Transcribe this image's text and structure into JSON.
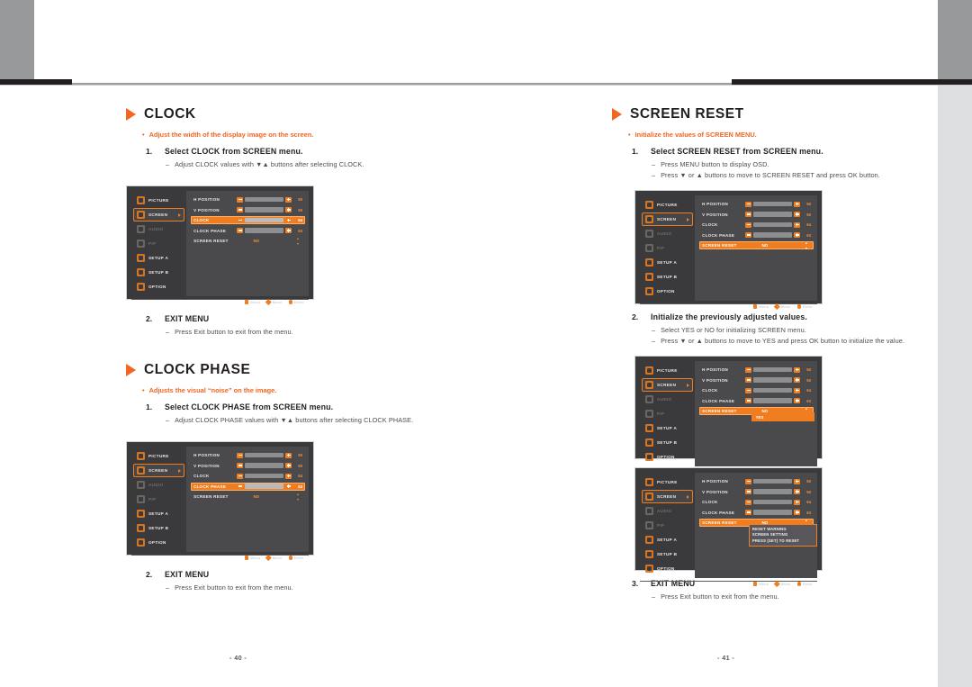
{
  "page": {
    "left_number": "- 40 -",
    "right_number": "- 41 -"
  },
  "accent": "#f26522",
  "osd_accent": "#f07d20",
  "osd": {
    "sidebar": [
      {
        "label": "PICTURE",
        "state": "normal",
        "icon": "picture-icon"
      },
      {
        "label": "SCREEN",
        "state": "selected",
        "icon": "screen-icon"
      },
      {
        "label": "AUDIO",
        "state": "dim",
        "icon": "audio-icon"
      },
      {
        "label": "PIP",
        "state": "dim",
        "icon": "pip-icon"
      },
      {
        "label": "SETUP A",
        "state": "normal",
        "icon": "setup-a-icon"
      },
      {
        "label": "SETUP B",
        "state": "normal",
        "icon": "setup-b-icon"
      },
      {
        "label": "OPTION",
        "state": "normal",
        "icon": "option-icon"
      }
    ],
    "rows": {
      "h_position": "H POSITION",
      "v_position": "V POSITION",
      "clock": "CLOCK",
      "clock_phase": "CLOCK PHASE",
      "screen_reset": "SCREEN RESET"
    },
    "values": {
      "h_position": "50",
      "v_position": "50",
      "clock": "64",
      "clock_phase": "63",
      "screen_reset": "NO"
    },
    "dropdown": {
      "no": "NO",
      "yes": "YES"
    },
    "warning": {
      "line1": "RESET WARNING",
      "line2": "SCREEN SETTING",
      "line3": "PRESS (SET) TO RESET"
    },
    "hints": [
      {
        "label": "Menu",
        "glyph": "square-icon"
      },
      {
        "label": "Move",
        "glyph": "diamond-icon"
      },
      {
        "label": "Enter",
        "glyph": "circle-icon"
      }
    ]
  },
  "left_column": {
    "clock": {
      "title": "CLOCK",
      "bullet": "Adjust the width of the display image on the screen.",
      "step1_num": "1.",
      "step1": "Select CLOCK from SCREEN menu.",
      "step1_sub1": "Adjust CLOCK values with ▼▲ buttons after selecting CLOCK.",
      "step2_num": "2.",
      "step2": "EXIT MENU",
      "step2_sub1": "Press Exit button to exit from the menu."
    },
    "clock_phase": {
      "title": "CLOCK PHASE",
      "bullet": "Adjusts the visual “noise” on the image.",
      "step1_num": "1.",
      "step1": "Select CLOCK PHASE from SCREEN menu.",
      "step1_sub1": "Adjust CLOCK PHASE values with ▼▲ buttons after selecting CLOCK PHASE.",
      "step2_num": "2.",
      "step2": "EXIT MENU",
      "step2_sub1": "Press Exit button to exit from the menu."
    }
  },
  "right_column": {
    "screen_reset": {
      "title": "SCREEN RESET",
      "bullet": "Initialize the values of SCREEN MENU.",
      "step1_num": "1.",
      "step1": "Select SCREEN RESET from SCREEN menu.",
      "step1_sub1": "Press MENU button to display OSD.",
      "step1_sub2": "Press ▼ or ▲ buttons to move to SCREEN RESET and press OK button.",
      "step2_num": "2.",
      "step2": "Initialize the previously adjusted values.",
      "step2_sub1": "Select YES or NO for initializing SCREEN menu.",
      "step2_sub2": "Press ▼ or ▲ buttons to move to YES and press OK button to initialize the value.",
      "step3_num": "3.",
      "step3": "EXIT MENU",
      "step3_sub1": "Press Exit button to exit from the menu."
    }
  }
}
